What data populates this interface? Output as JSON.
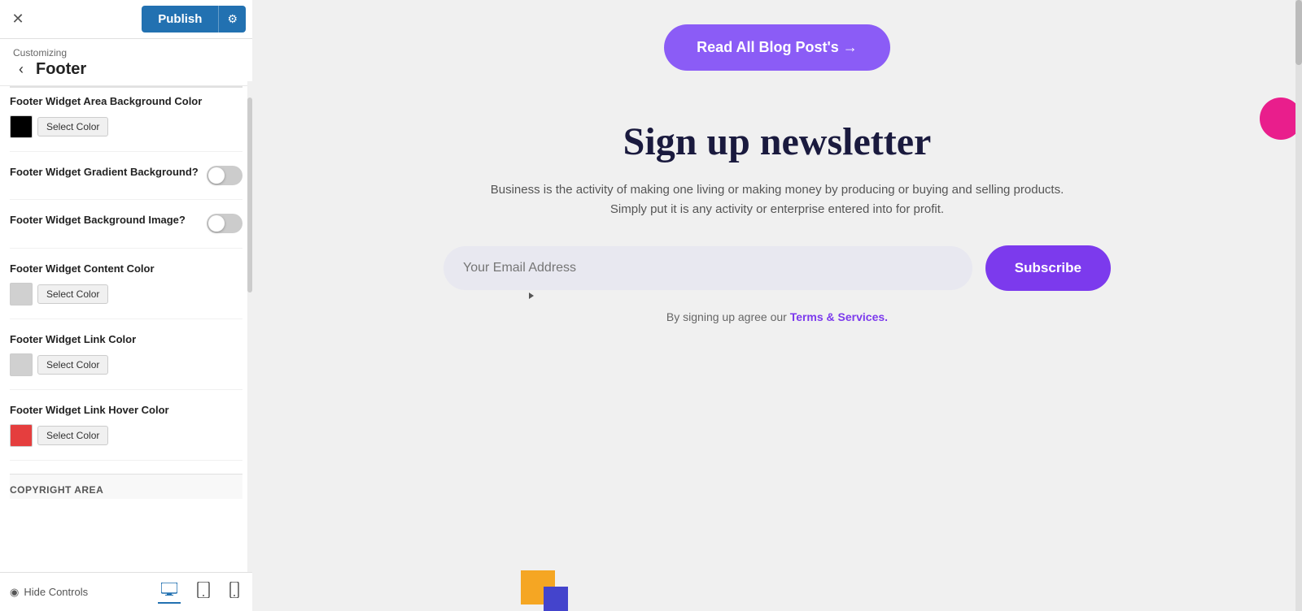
{
  "topbar": {
    "close_label": "✕",
    "publish_label": "Publish",
    "settings_icon": "⚙"
  },
  "breadcrumb": {
    "customizing_label": "Customizing",
    "section_title": "Footer",
    "back_icon": "‹"
  },
  "settings": {
    "footer_widget_bg_color_label": "Footer Widget Area Background Color",
    "footer_widget_bg_color_select": "Select Color",
    "footer_widget_gradient_label": "Footer Widget Gradient Background?",
    "footer_widget_bg_image_label": "Footer Widget Background Image?",
    "footer_widget_content_color_label": "Footer Widget Content Color",
    "footer_widget_content_color_select": "Select Color",
    "footer_widget_link_color_label": "Footer Widget Link Color",
    "footer_widget_link_color_select": "Select Color",
    "footer_widget_link_hover_label": "Footer Widget Link Hover Color",
    "footer_widget_link_hover_select": "Select Color",
    "copyright_area_label": "COPYRIGHT AREA"
  },
  "colors": {
    "widget_bg": "#000000",
    "content_color": "#d0d0d0",
    "link_color": "#d0d0d0",
    "link_hover_color": "#e53e3e"
  },
  "bottom_bar": {
    "hide_controls_label": "Hide Controls",
    "hide_controls_icon": "◉",
    "desktop_icon": "🖥",
    "tablet_icon": "▭",
    "mobile_icon": "📱"
  },
  "preview": {
    "read_all_btn_label": "Read All Blog Post's →",
    "newsletter_title": "Sign up newsletter",
    "newsletter_desc_line1": "Business is the activity of making one living or making money by producing or buying and selling products.",
    "newsletter_desc_line2": "Simply put it is any activity or enterprise entered into for profit.",
    "email_placeholder": "Your Email Address",
    "subscribe_btn_label": "Subscribe",
    "terms_text": "By signing up agree our",
    "terms_link_text": "Terms & Services."
  }
}
